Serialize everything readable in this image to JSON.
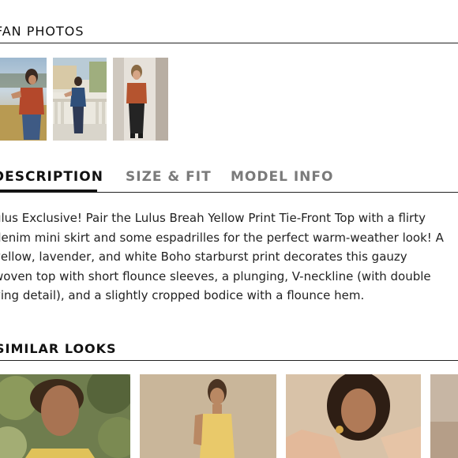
{
  "fan_photos": {
    "title": "FAN PHOTOS",
    "photos": [
      {
        "name": "fan-photo-1",
        "alt": "Fan photo 1"
      },
      {
        "name": "fan-photo-2",
        "alt": "Fan photo 2"
      },
      {
        "name": "fan-photo-3",
        "alt": "Fan photo 3"
      }
    ]
  },
  "tabs": [
    {
      "label": "DESCRIPTION",
      "active": true
    },
    {
      "label": "SIZE & FIT",
      "active": false
    },
    {
      "label": "MODEL INFO",
      "active": false
    }
  ],
  "description": {
    "lines": [
      "ulus Exclusive! Pair the Lulus Breah Yellow Print Tie-Front Top with a flirty",
      "denim mini skirt and some espadrilles for the perfect warm-weather look! A",
      "yellow, lavender, and white Boho starburst print decorates this gauzy",
      "woven top with short flounce sleeves, a plunging, V-neckline (with double",
      "ying detail), and a slightly cropped bodice with a flounce hem."
    ]
  },
  "similar_looks": {
    "title": "SIMILAR LOOKS",
    "items": [
      {
        "name": "look-1",
        "alt": "Similar look 1"
      },
      {
        "name": "look-2",
        "alt": "Similar look 2"
      },
      {
        "name": "look-3",
        "alt": "Similar look 3"
      },
      {
        "name": "look-4",
        "alt": "Similar look 4"
      }
    ]
  },
  "colors": {
    "active_tab": "#111111",
    "inactive_tab": "#7a7a7a",
    "rule": "#222222"
  }
}
